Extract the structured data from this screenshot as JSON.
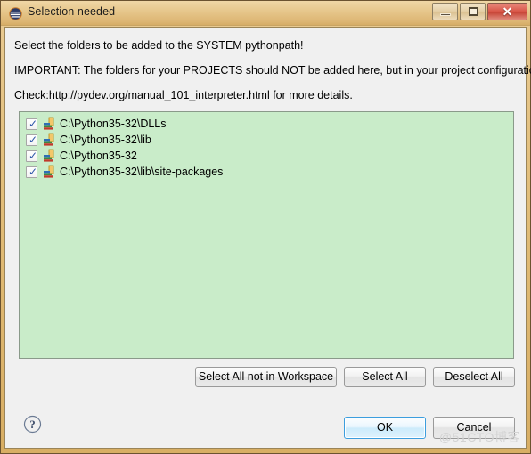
{
  "window": {
    "title": "Selection needed",
    "app_icon": "eclipse-icon",
    "controls": {
      "minimize": "–",
      "maximize": "□",
      "close": "✕"
    }
  },
  "messages": {
    "line1": "Select the folders to be added to the SYSTEM pythonpath!",
    "line2": "IMPORTANT: The folders for your PROJECTS should NOT be added here, but in your project configuration.",
    "line3": "Check:http://pydev.org/manual_101_interpreter.html for more details."
  },
  "list": {
    "background_color": "#c9ecc9",
    "items": [
      {
        "checked": true,
        "icon": "library-folder-icon",
        "label": "C:\\Python35-32\\DLLs"
      },
      {
        "checked": true,
        "icon": "library-folder-icon",
        "label": "C:\\Python35-32\\lib"
      },
      {
        "checked": true,
        "icon": "library-folder-icon",
        "label": "C:\\Python35-32"
      },
      {
        "checked": true,
        "icon": "library-folder-icon",
        "label": "C:\\Python35-32\\lib\\site-packages"
      }
    ]
  },
  "selection_buttons": {
    "select_all_not_in_workspace": "Select All not in Workspace",
    "select_all": "Select All",
    "deselect_all": "Deselect All"
  },
  "footer": {
    "help_icon": "help-question-icon",
    "ok": "OK",
    "cancel": "Cancel",
    "ok_accent_color": "#3c9ede"
  },
  "watermark": "@51CTO博客"
}
